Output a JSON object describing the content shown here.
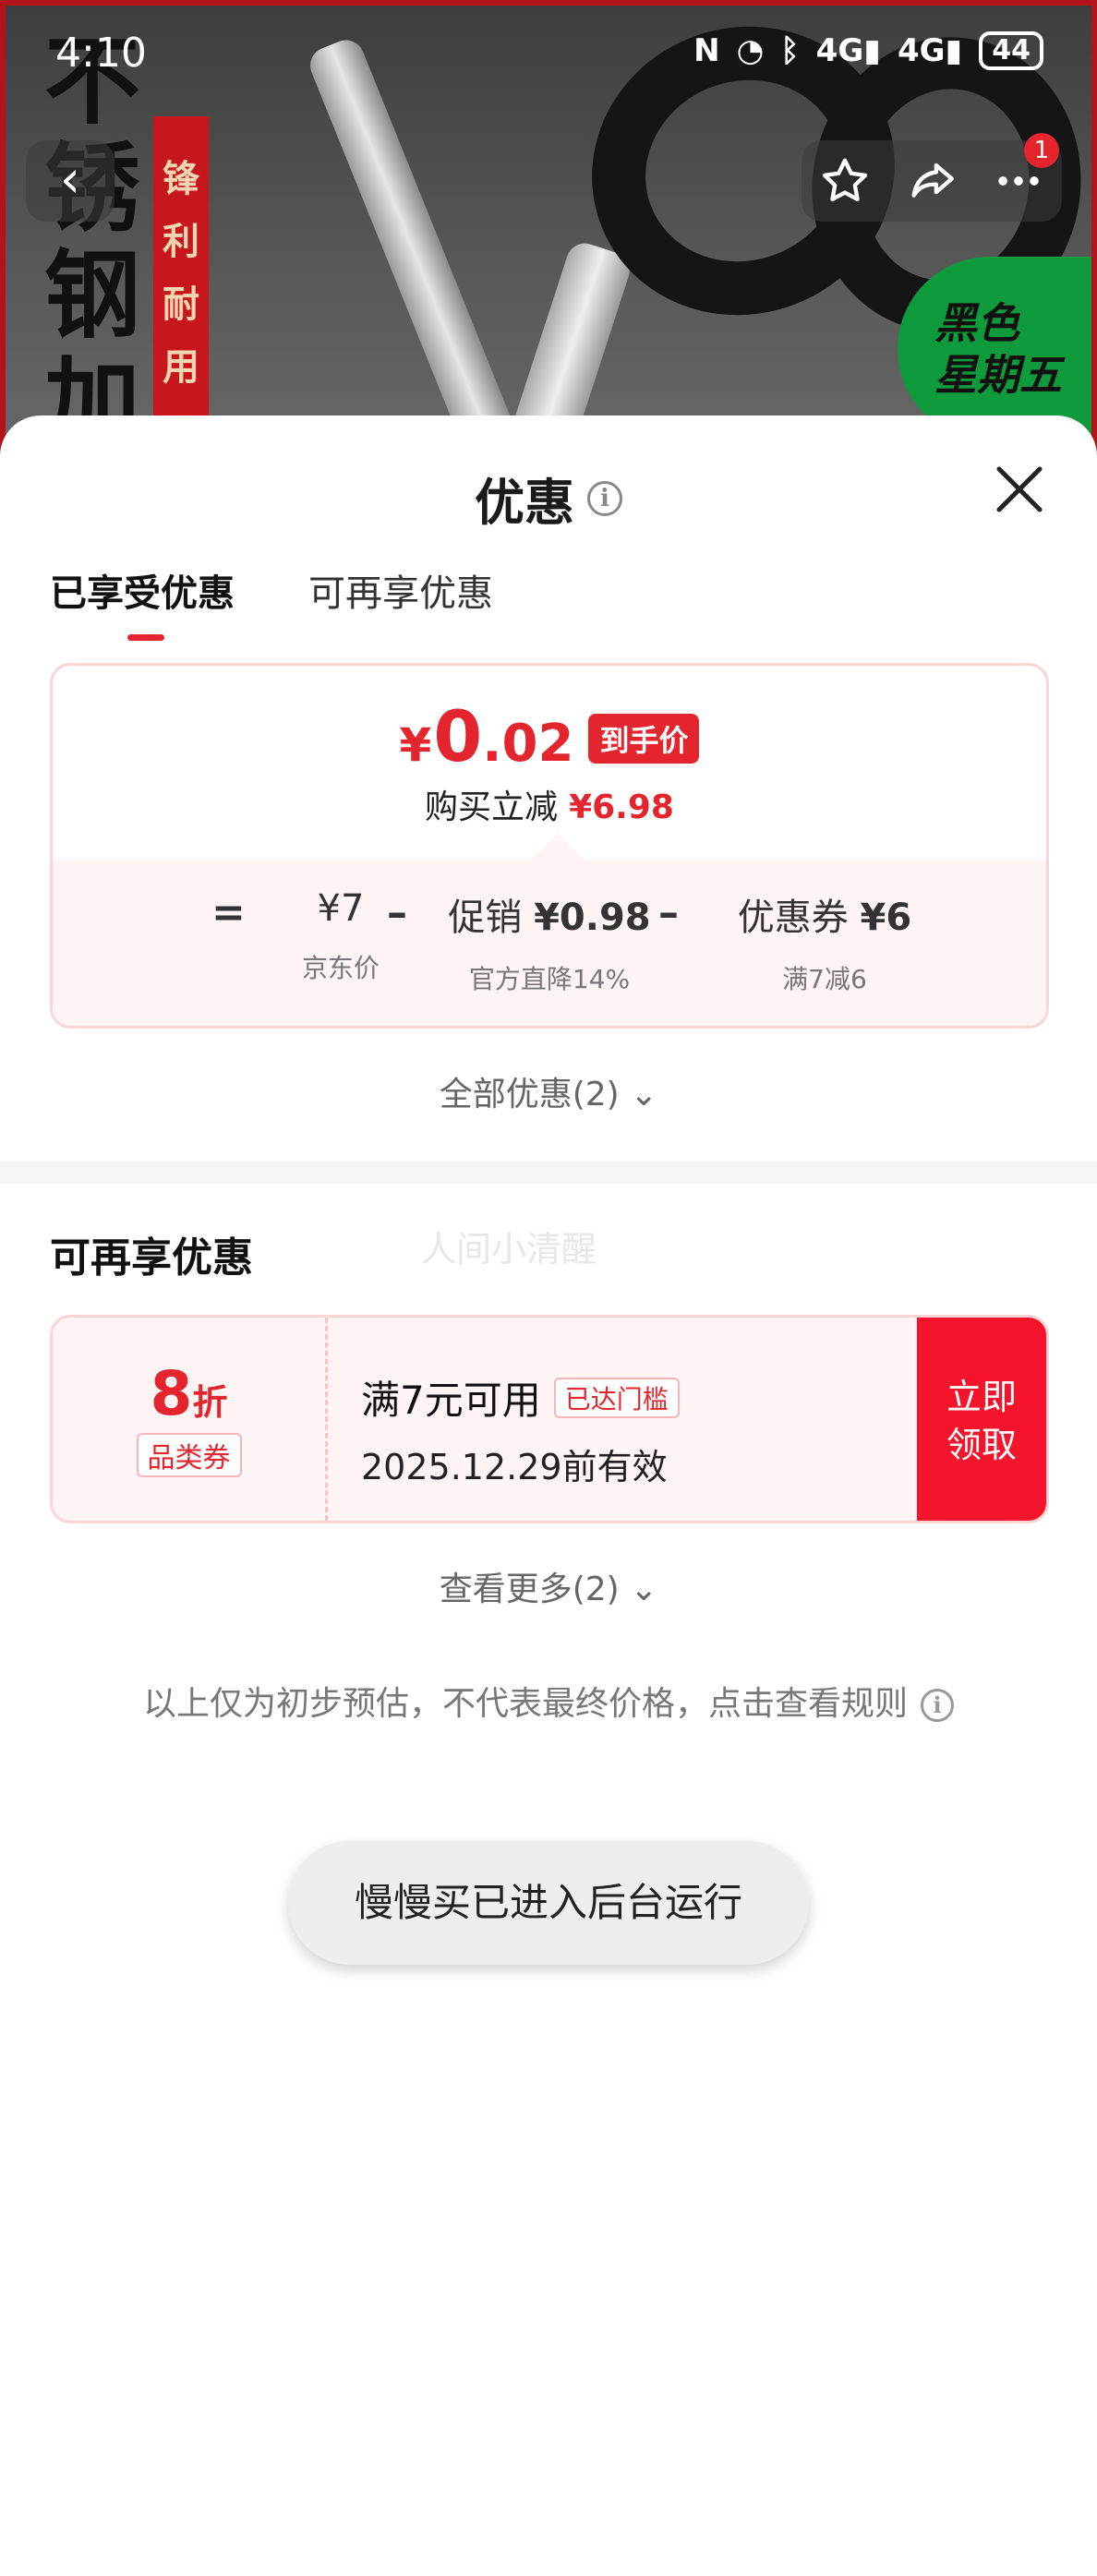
{
  "status_bar": {
    "time": "4:10",
    "network_1": "4G",
    "network_2": "4G",
    "battery": "44"
  },
  "background": {
    "vertical_title": "不锈钢加",
    "red_strip": "锋利耐用",
    "green_badge_line1": "黑色",
    "green_badge_line2": "星期五"
  },
  "nav": {
    "notification_count": "1"
  },
  "sheet": {
    "title": "优惠",
    "tabs": [
      {
        "label": "已享受优惠",
        "active": true
      },
      {
        "label": "可再享优惠",
        "active": false
      }
    ],
    "price_card": {
      "final_price_int": "0",
      "final_price_dec": ".02",
      "currency": "¥",
      "final_price_tag": "到手价",
      "discount_label": "购买立减",
      "discount_amount": "¥6.98",
      "formula": {
        "equals": "=",
        "minus": "–",
        "jd_price": "¥7",
        "jd_price_label": "京东价",
        "promo_label": "促销",
        "promo_amount": "¥0.98",
        "promo_sub": "官方直降14%",
        "coupon_label": "优惠券",
        "coupon_amount": "¥6",
        "coupon_sub": "满7减6"
      }
    },
    "all_discounts_link": "全部优惠(2)",
    "section_title": "可再享优惠",
    "watermark": "人间小清醒",
    "coupon": {
      "discount_number": "8",
      "discount_unit": "折",
      "coupon_type": "品类券",
      "condition": "满7元可用",
      "threshold_badge": "已达门槛",
      "validity": "2025.12.29前有效",
      "claim_line1": "立即",
      "claim_line2": "领取"
    },
    "see_more_link": "查看更多(2)",
    "disclaimer": "以上仅为初步预估，不代表最终价格，点击查看规则"
  },
  "toast": "慢慢买已进入后台运行",
  "colors": {
    "accent": "#e4252e",
    "claim_button": "#f5142c",
    "card_border": "#fbd4d6",
    "card_bg": "#fff4f4"
  }
}
